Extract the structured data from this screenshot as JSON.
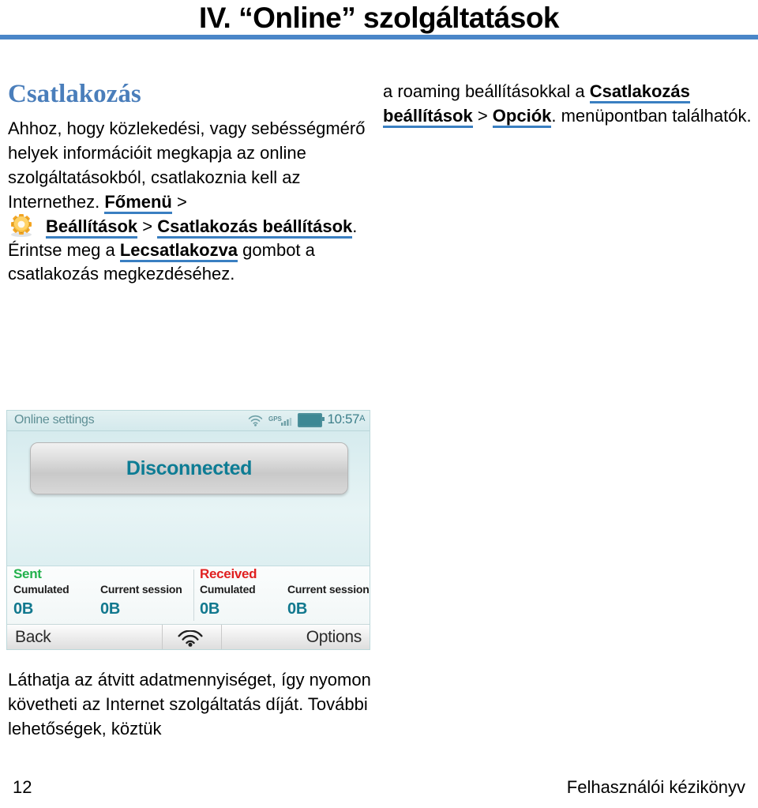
{
  "header": {
    "title": "IV. “Online” szolgáltatások",
    "rule_color": "#4a86c8"
  },
  "left_column": {
    "heading": "Csatlakozás",
    "heading_color": "#4a7ebb",
    "paragraph1": {
      "text_before": "Ahhoz, hogy közlekedési, vagy sebésségmérő helyek információit megkapja az online szolgáltatásokból, csatlakoznia kell az Internethez. ",
      "link1": "Főmenü",
      "sep1": " > "
    },
    "paragraph2": {
      "icon": "gear-icon",
      "link2": "Beállítások",
      "sep2": " > ",
      "link3": "Csatlakozás beállítások",
      "text_mid": ". Érintse meg a ",
      "link4": "Lecsatlakozva",
      "text_after": " gombot a csatlakozás megkezdéséhez."
    }
  },
  "right_column": {
    "text_before": "a roaming beállításokkal a ",
    "link1": "Csatlakozás beállítások",
    "sep1": " > ",
    "link2": "Opciók",
    "text_after": ". menüpontban találhatók."
  },
  "phone_screenshot": {
    "status_bar": {
      "title": "Online settings",
      "wifi_icon": "wifi-icon",
      "gps_icon": "gps-signal-icon",
      "gps_label": "GPS",
      "battery_icon": "battery-icon",
      "time": "10:57",
      "am_pm": "A"
    },
    "connection_button": {
      "label": "Disconnected",
      "text_color": "#0d7c94"
    },
    "stats": {
      "groups": [
        {
          "name": "Sent",
          "color": "#22b14c"
        },
        {
          "name": "Received",
          "color": "#e02020"
        }
      ],
      "columns": [
        {
          "group": "Sent",
          "label": "Cumulated",
          "value": "0B"
        },
        {
          "group": "Sent",
          "label": "Current session",
          "value": "0B"
        },
        {
          "group": "Received",
          "label": "Cumulated",
          "value": "0B"
        },
        {
          "group": "Received",
          "label": "Current session",
          "value": "0B"
        }
      ],
      "value_color": "#11788e"
    },
    "bottom_bar": {
      "back_label": "Back",
      "center_icon": "wifi-icon",
      "options_label": "Options"
    }
  },
  "bottom_paragraph": {
    "text": "Láthatja az átvitt adatmennyiséget, így nyomon követheti az Internet szolgáltatás díját. További lehetőségek, köztük"
  },
  "footer": {
    "page_number": "12",
    "label": "Felhasználói kézikönyv"
  }
}
